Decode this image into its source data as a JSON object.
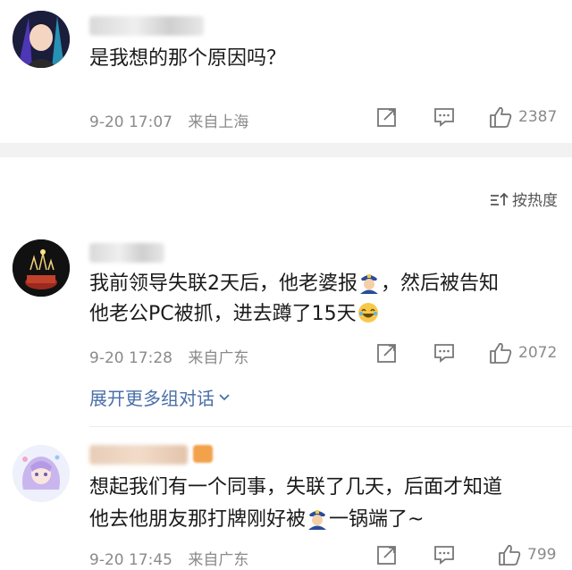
{
  "comments": [
    {
      "text_line1": "是我想的那个原因吗？",
      "time": "9-20 17:07",
      "location": "来自上海",
      "likes": "2387"
    },
    {
      "text_line1_a": "我前领导失联2天后，他老婆报",
      "text_line1_b": "，然后被告知",
      "text_line2_a": "他老公PC被抓，进去蹲了15天",
      "time": "9-20 17:28",
      "location": "来自广东",
      "likes": "2072"
    },
    {
      "text_line1": "想起我们有一个同事，失联了几天，后面才知道",
      "text_line2_a": "他去他朋友那打牌刚好被",
      "text_line2_b": "一锅端了~",
      "time": "9-20 17:45",
      "location": "来自广东",
      "likes": "799"
    }
  ],
  "sort": {
    "label": "按热度"
  },
  "expand": {
    "label": "展开更多组对话"
  },
  "colors": {
    "link": "#4a6fa8",
    "meta": "#8a8a8a",
    "divider": "#f2f2f2"
  },
  "icons": [
    "share-icon",
    "comment-icon",
    "like-icon",
    "sort-icon",
    "chevron-down-icon",
    "police-emoji",
    "laugh-emoji"
  ]
}
